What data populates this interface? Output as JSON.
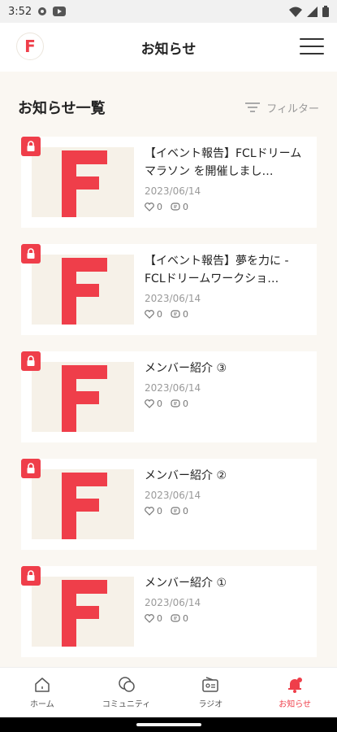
{
  "status_bar": {
    "time": "3:52"
  },
  "header": {
    "logo_letter": "F",
    "title": "お知らせ"
  },
  "section": {
    "title": "お知らせ一覧",
    "filter_label": "フィルター"
  },
  "news": [
    {
      "title": "【イベント報告】FCLドリームマラソン を開催しまし…",
      "date": "2023/06/14",
      "likes": "0",
      "comments": "0"
    },
    {
      "title": "【イベント報告】夢を力に -FCLドリームワークショ…",
      "date": "2023/06/14",
      "likes": "0",
      "comments": "0"
    },
    {
      "title": "メンバー紹介 ③",
      "date": "2023/06/14",
      "likes": "0",
      "comments": "0"
    },
    {
      "title": "メンバー紹介 ②",
      "date": "2023/06/14",
      "likes": "0",
      "comments": "0"
    },
    {
      "title": "メンバー紹介 ①",
      "date": "2023/06/14",
      "likes": "0",
      "comments": "0"
    }
  ],
  "tabs": [
    {
      "label": "ホーム",
      "icon": "home-icon"
    },
    {
      "label": "コミュニティ",
      "icon": "chat-bubbles-icon"
    },
    {
      "label": "ラジオ",
      "icon": "radio-icon"
    },
    {
      "label": "お知らせ",
      "icon": "bell-icon",
      "active": true
    }
  ],
  "colors": {
    "accent": "#ef3e4a",
    "background": "#faf7f2",
    "thumb_bg": "#f6f1e8"
  }
}
